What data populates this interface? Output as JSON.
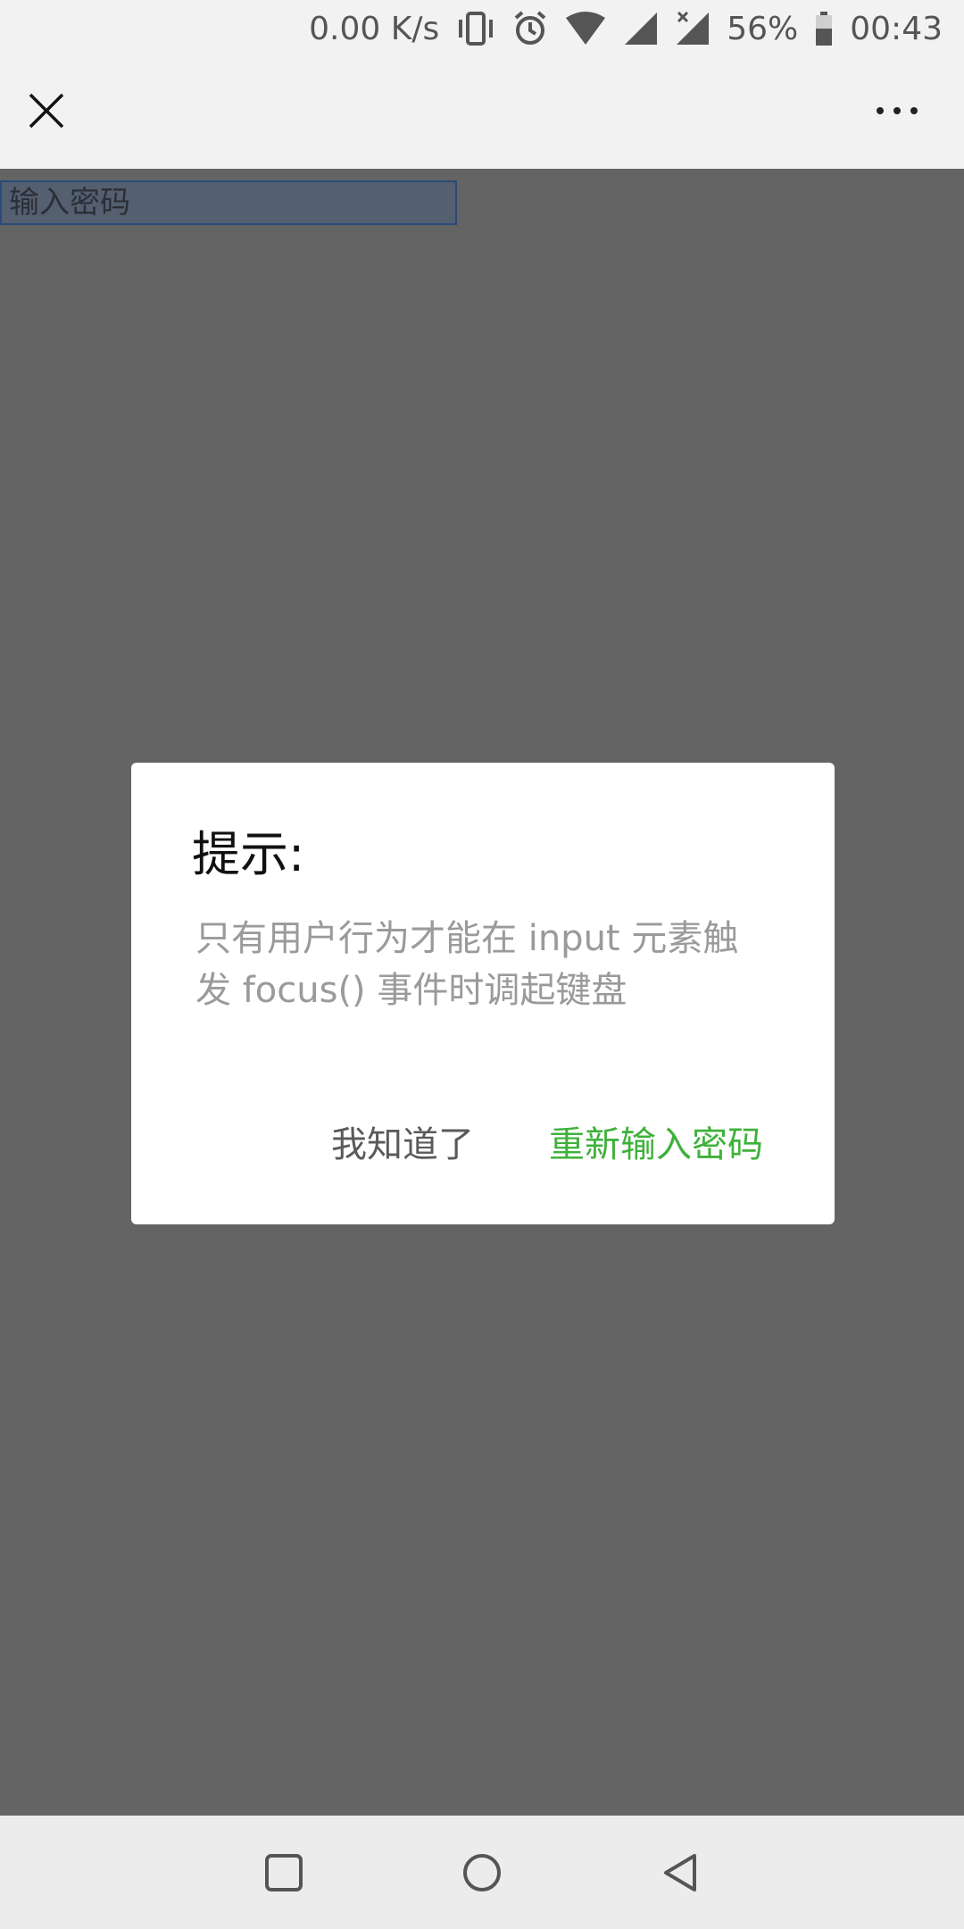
{
  "status_bar": {
    "net_speed": "0.00 K/s",
    "battery": "56%",
    "time": "00:43",
    "icons": [
      "vibrate-icon",
      "alarm-icon",
      "wifi-icon",
      "signal-icon",
      "signal-no-data-icon",
      "battery-icon"
    ]
  },
  "title_bar": {
    "close_icon": "close-icon",
    "more_icon": "more-dots-icon"
  },
  "page": {
    "password_placeholder": "输入密码"
  },
  "dialog": {
    "title": "提示:",
    "message": "只有用户行为才能在 input 元素触发 focus() 事件时调起键盘",
    "btn_ok": "我知道了",
    "btn_retry": "重新输入密码",
    "colors": {
      "retry": "#3fb13b",
      "ok": "#5a5a5a",
      "message": "#9a9a9a"
    }
  },
  "nav_bar": {
    "icons": [
      "recent-apps-icon",
      "home-icon",
      "back-icon"
    ]
  }
}
